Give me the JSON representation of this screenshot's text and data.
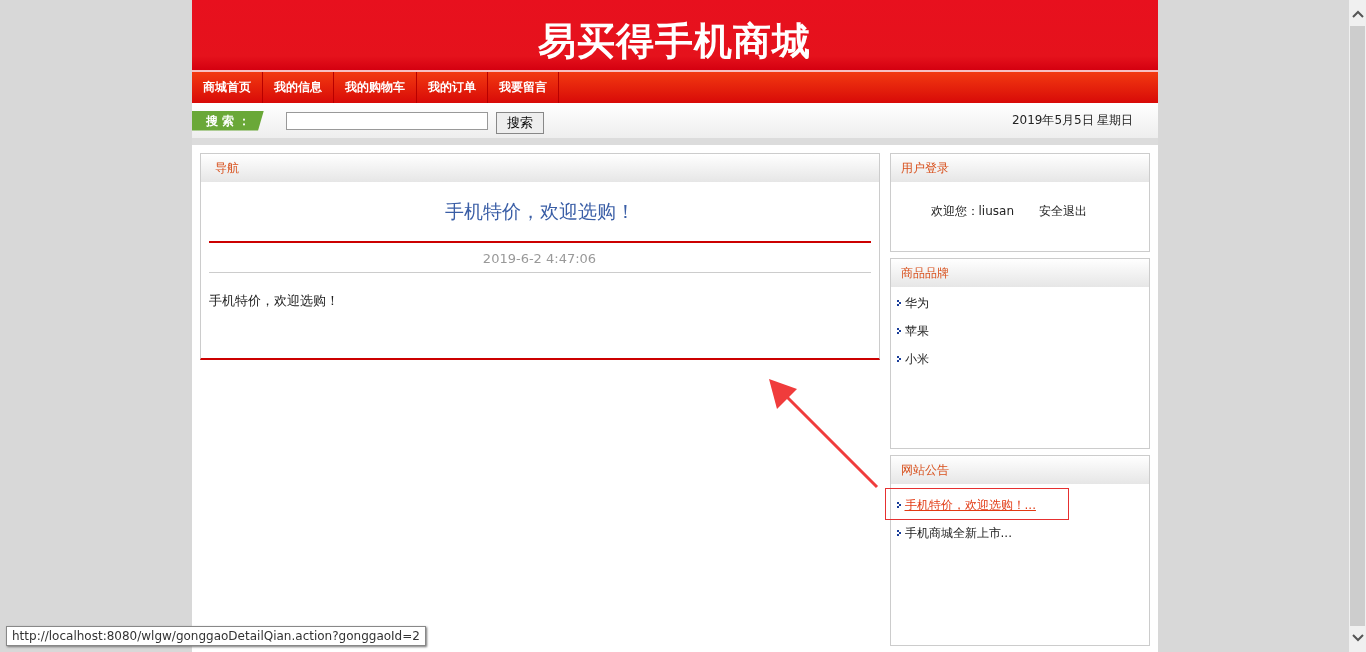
{
  "header": {
    "title": "易买得手机商城"
  },
  "nav": {
    "items": [
      {
        "label": "商城首页"
      },
      {
        "label": "我的信息"
      },
      {
        "label": "我的购物车"
      },
      {
        "label": "我的订单"
      },
      {
        "label": "我要留言"
      }
    ]
  },
  "search": {
    "label": "搜 索 ：",
    "button": "搜索",
    "date": "2019年5月5日  星期日"
  },
  "article": {
    "panel_title": "导航",
    "title": "手机特价，欢迎选购！",
    "time": "2019-6-2 4:47:06",
    "body": "手机特价，欢迎选购！"
  },
  "login": {
    "panel_title": "用户登录",
    "welcome": "欢迎您：liusan",
    "logout": "安全退出"
  },
  "brands": {
    "panel_title": "商品品牌",
    "items": [
      {
        "label": "华为"
      },
      {
        "label": "苹果"
      },
      {
        "label": "小米"
      }
    ]
  },
  "notices": {
    "panel_title": "网站公告",
    "items": [
      {
        "label": "手机特价，欢迎选购！...",
        "hovered": true
      },
      {
        "label": "手机商城全新上市...",
        "hovered": false
      }
    ]
  },
  "status_bar": {
    "url": "http://localhost:8080/wlgw/gonggaoDetailQian.action?gonggaoId=2"
  }
}
